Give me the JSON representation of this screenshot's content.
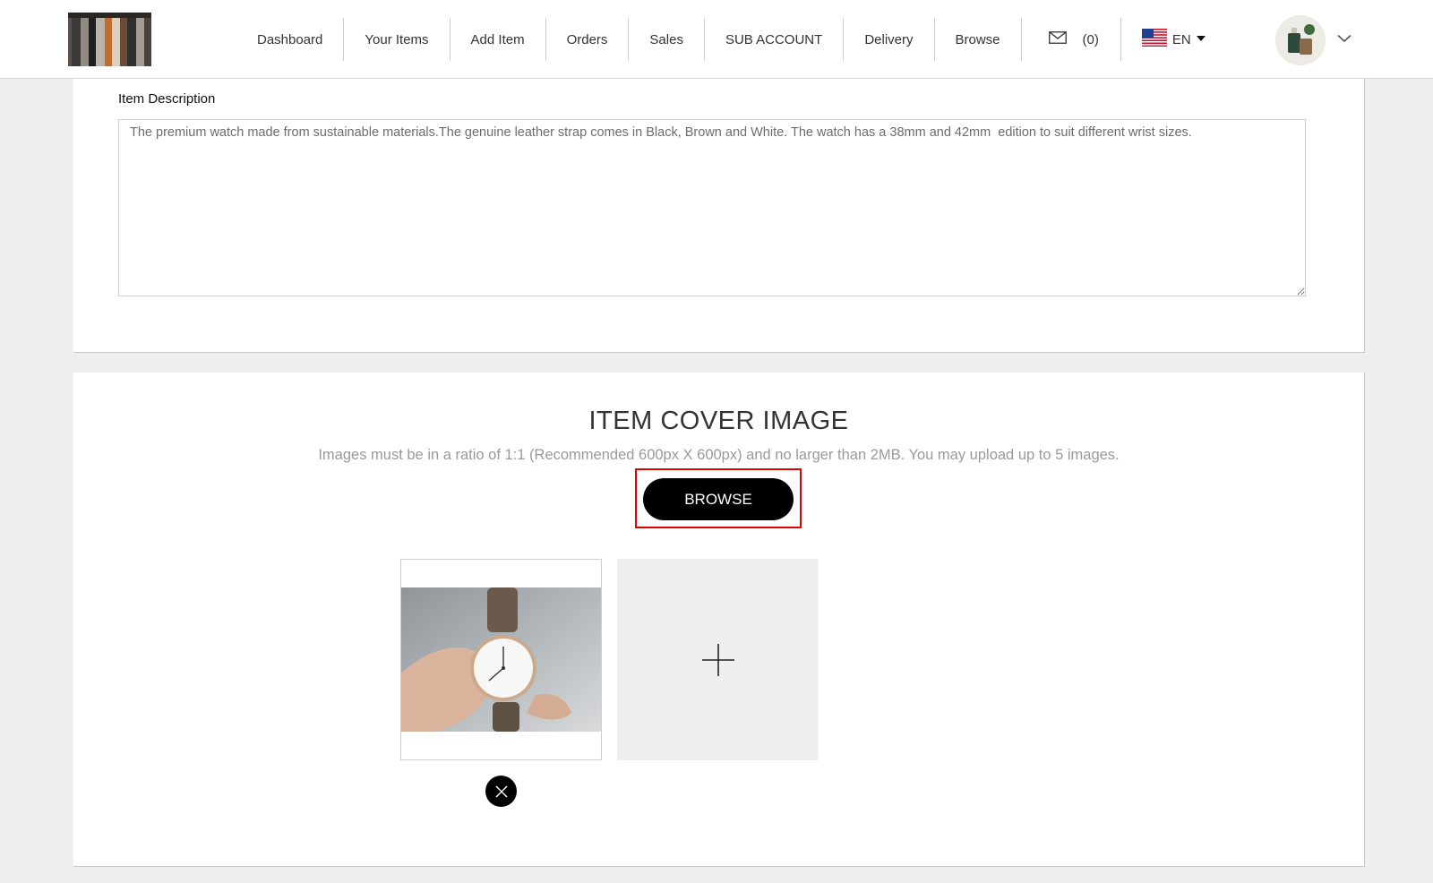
{
  "header": {
    "logo_icon": "clothes-rack-logo",
    "nav": [
      {
        "label": "Dashboard"
      },
      {
        "label": "Your Items"
      },
      {
        "label": "Add Item"
      },
      {
        "label": "Orders"
      },
      {
        "label": "Sales"
      },
      {
        "label": "SUB ACCOUNT"
      },
      {
        "label": "Delivery"
      },
      {
        "label": "Browse"
      }
    ],
    "mail_icon": "envelope-icon",
    "mail_count": "(0)",
    "language": "EN",
    "language_flag": "us-flag-icon"
  },
  "description": {
    "label": "Item Description",
    "value": "The premium watch made from sustainable materials.The genuine leather strap comes in Black, Brown and White. The watch has a 38mm and 42mm  edition to suit different wrist sizes."
  },
  "cover": {
    "title": "ITEM COVER IMAGE",
    "hint": "Images must be in a ratio of 1:1 (Recommended 600px X 600px) and no larger than 2MB. You may upload up to 5 images.",
    "browse_label": "BROWSE"
  },
  "colors": {
    "button_bg": "#000000",
    "highlight_border": "#e00000",
    "page_bg": "#efefef"
  }
}
